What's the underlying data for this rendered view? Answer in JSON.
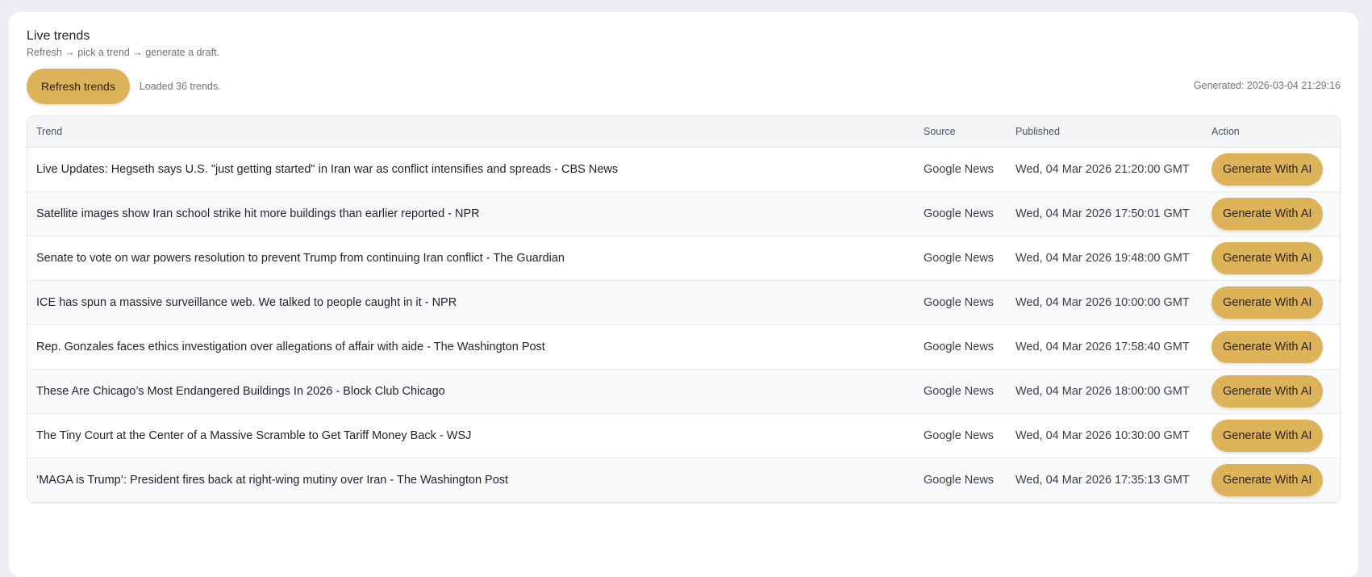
{
  "header": {
    "title": "Live trends",
    "subtitle": "Refresh → pick a trend → generate a draft."
  },
  "toolbar": {
    "refresh_label": "Refresh trends",
    "status": "Loaded 36 trends.",
    "generated": "Generated: 2026-03-04 21:29:16"
  },
  "table": {
    "columns": [
      "Trend",
      "Source",
      "Published",
      "Action"
    ],
    "rows": [
      {
        "trend": "Live Updates: Hegseth says U.S. \"just getting started\" in Iran war as conflict intensifies and spreads - CBS News",
        "source": "Google News",
        "published": "Wed, 04 Mar 2026 21:20:00 GMT",
        "action": "Generate With AI"
      },
      {
        "trend": "Satellite images show Iran school strike hit more buildings than earlier reported - NPR",
        "source": "Google News",
        "published": "Wed, 04 Mar 2026 17:50:01 GMT",
        "action": "Generate With AI"
      },
      {
        "trend": "Senate to vote on war powers resolution to prevent Trump from continuing Iran conflict - The Guardian",
        "source": "Google News",
        "published": "Wed, 04 Mar 2026 19:48:00 GMT",
        "action": "Generate With AI"
      },
      {
        "trend": "ICE has spun a massive surveillance web. We talked to people caught in it - NPR",
        "source": "Google News",
        "published": "Wed, 04 Mar 2026 10:00:00 GMT",
        "action": "Generate With AI"
      },
      {
        "trend": "Rep. Gonzales faces ethics investigation over allegations of affair with aide - The Washington Post",
        "source": "Google News",
        "published": "Wed, 04 Mar 2026 17:58:40 GMT",
        "action": "Generate With AI"
      },
      {
        "trend": "These Are Chicago’s Most Endangered Buildings In 2026 - Block Club Chicago",
        "source": "Google News",
        "published": "Wed, 04 Mar 2026 18:00:00 GMT",
        "action": "Generate With AI"
      },
      {
        "trend": "The Tiny Court at the Center of a Massive Scramble to Get Tariff Money Back - WSJ",
        "source": "Google News",
        "published": "Wed, 04 Mar 2026 10:30:00 GMT",
        "action": "Generate With AI"
      },
      {
        "trend": "‘MAGA is Trump’: President fires back at right-wing mutiny over Iran - The Washington Post",
        "source": "Google News",
        "published": "Wed, 04 Mar 2026 17:35:13 GMT",
        "action": "Generate With AI"
      }
    ]
  },
  "colors": {
    "accent": "#ddb35a",
    "page_bg": "#eceef1",
    "card_bg": "#ffffff"
  }
}
